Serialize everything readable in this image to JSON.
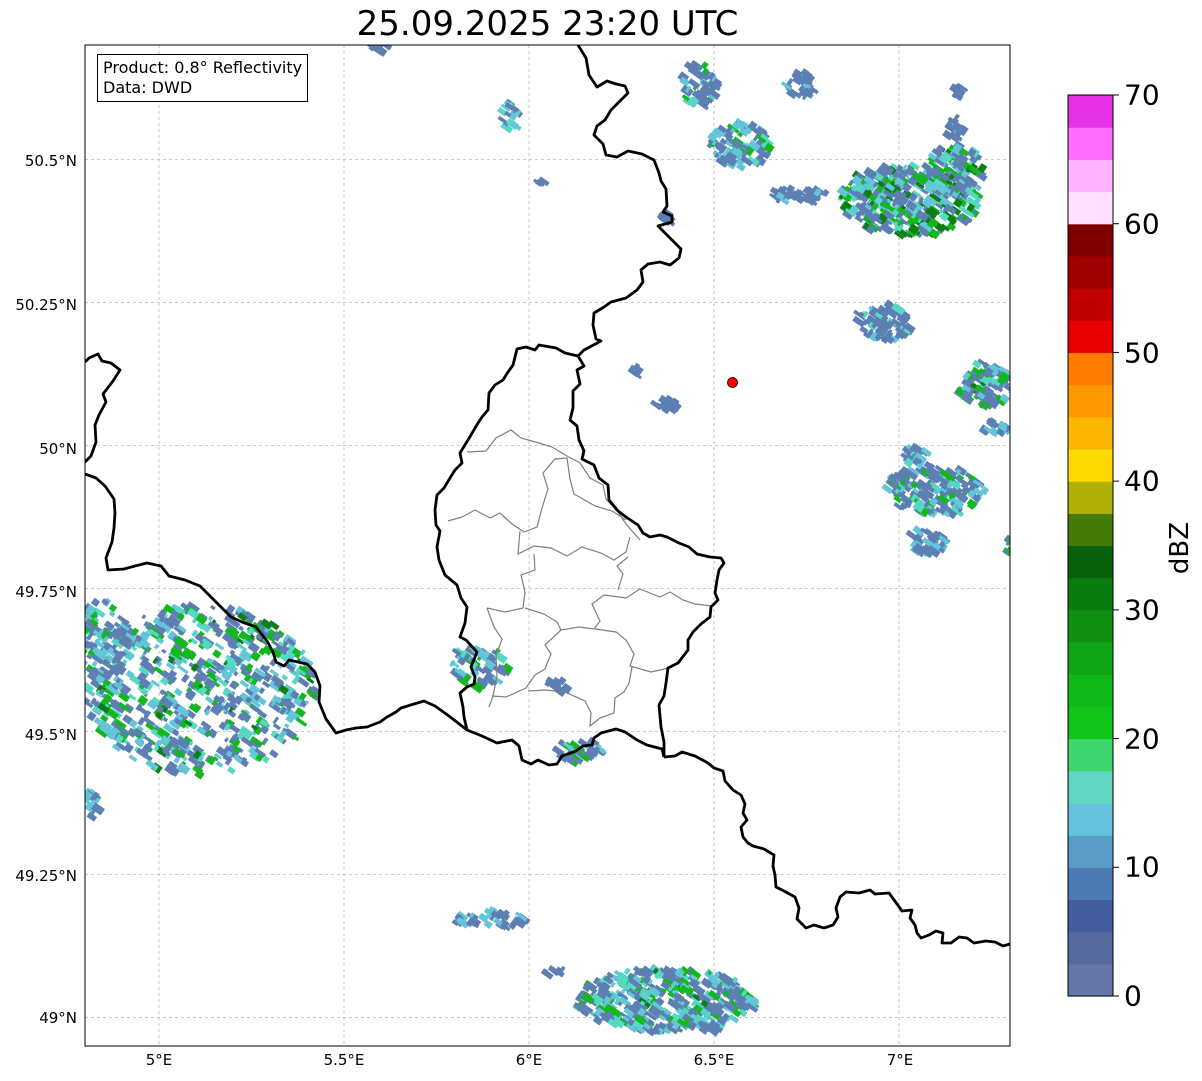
{
  "title": "25.09.2025 23:20 UTC",
  "info": {
    "product": "Product: 0.8° Reflectivity",
    "source": "Data: DWD"
  },
  "map_extent": {
    "lon_min": 4.8,
    "lon_max": 7.3,
    "lat_min": 48.95,
    "lat_max": 50.7
  },
  "x_ticks": [
    "5°E",
    "5.5°E",
    "6°E",
    "6.5°E",
    "7°E"
  ],
  "y_ticks": [
    "49°N",
    "49.25°N",
    "49.5°N",
    "49.75°N",
    "50°N",
    "50.25°N",
    "50.5°N"
  ],
  "marker": {
    "lon": 6.55,
    "lat": 50.11,
    "color": "#ff0000"
  },
  "colorbar": {
    "label": "dBZ",
    "ticks": [
      "0",
      "10",
      "20",
      "30",
      "40",
      "50",
      "60",
      "70"
    ],
    "min": 0,
    "max": 70,
    "colors": [
      "#6674a6",
      "#56699f",
      "#455d9f",
      "#4b7bb2",
      "#5b9cc6",
      "#66c1dc",
      "#5ed6c0",
      "#3ed46e",
      "#11c51a",
      "#10b81a",
      "#10a516",
      "#0f9013",
      "#0c7b10",
      "#07610d",
      "#457a09",
      "#b0b00a",
      "#fdd900",
      "#fcb600",
      "#fd9800",
      "#fd7b00",
      "#e60000",
      "#c00000",
      "#a00000",
      "#800000",
      "#ffe0ff",
      "#ffb4ff",
      "#ff6cff",
      "#e632e6"
    ]
  },
  "echo_palette": {
    "light": "#5d7fb3",
    "mid": "#63c6d8",
    "cyan": "#56d9c2",
    "green": "#12b81c",
    "dark": "#0a7f12"
  }
}
